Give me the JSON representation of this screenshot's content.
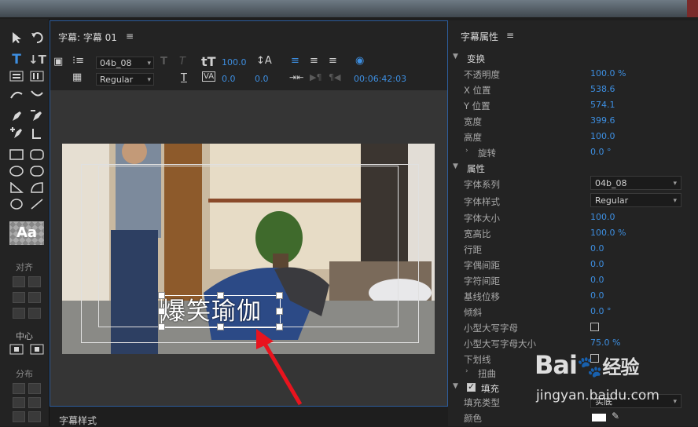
{
  "title_panel": {
    "title": "字幕: 字幕 01",
    "toolbar": {
      "font_family": "04b_08",
      "font_style": "Regular",
      "font_size": "100.0",
      "tracking_value": "0.0",
      "kerning_value": "0.0",
      "timecode": "00:06:42:03"
    },
    "caption_text": "爆笑瑜伽"
  },
  "tools": {
    "align_label": "对齐",
    "center_label": "中心",
    "distribute_label": "分布",
    "style_preview": "Aa"
  },
  "bottom_tab": {
    "label": "字幕样式"
  },
  "properties": {
    "panel_title": "字幕属性",
    "transform": {
      "header": "变换",
      "opacity_label": "不透明度",
      "opacity": "100.0 %",
      "x_label": "X 位置",
      "x": "538.6",
      "y_label": "Y 位置",
      "y": "574.1",
      "width_label": "宽度",
      "width": "399.6",
      "height_label": "高度",
      "height": "100.0",
      "rotation_label": "旋转",
      "rotation": "0.0 °"
    },
    "attributes": {
      "header": "属性",
      "font_family_label": "字体系列",
      "font_family": "04b_08",
      "font_style_label": "字体样式",
      "font_style": "Regular",
      "font_size_label": "字体大小",
      "font_size": "100.0",
      "aspect_label": "宽高比",
      "aspect": "100.0 %",
      "leading_label": "行距",
      "leading": "0.0",
      "kerning_label": "字偶间距",
      "kerning": "0.0",
      "tracking_label": "字符间距",
      "tracking": "0.0",
      "baseline_label": "基线位移",
      "baseline": "0.0",
      "slant_label": "倾斜",
      "slant": "0.0 °",
      "small_caps_label": "小型大写字母",
      "small_caps_size_label": "小型大写字母大小",
      "small_caps_size": "75.0 %",
      "underline_label": "下划线",
      "distort_label": "扭曲"
    },
    "fill": {
      "header": "填充",
      "fill_type_label": "填充类型",
      "fill_type": "实底",
      "color_label": "颜色",
      "color": "#ffffff"
    }
  },
  "watermark": {
    "brand": "Bai",
    "brand2": "经验",
    "url": "jingyan.baidu.com"
  },
  "colors": {
    "accent": "#3d8ee0",
    "panel_border": "#2d5e9e",
    "arrow": "#e8141e"
  }
}
